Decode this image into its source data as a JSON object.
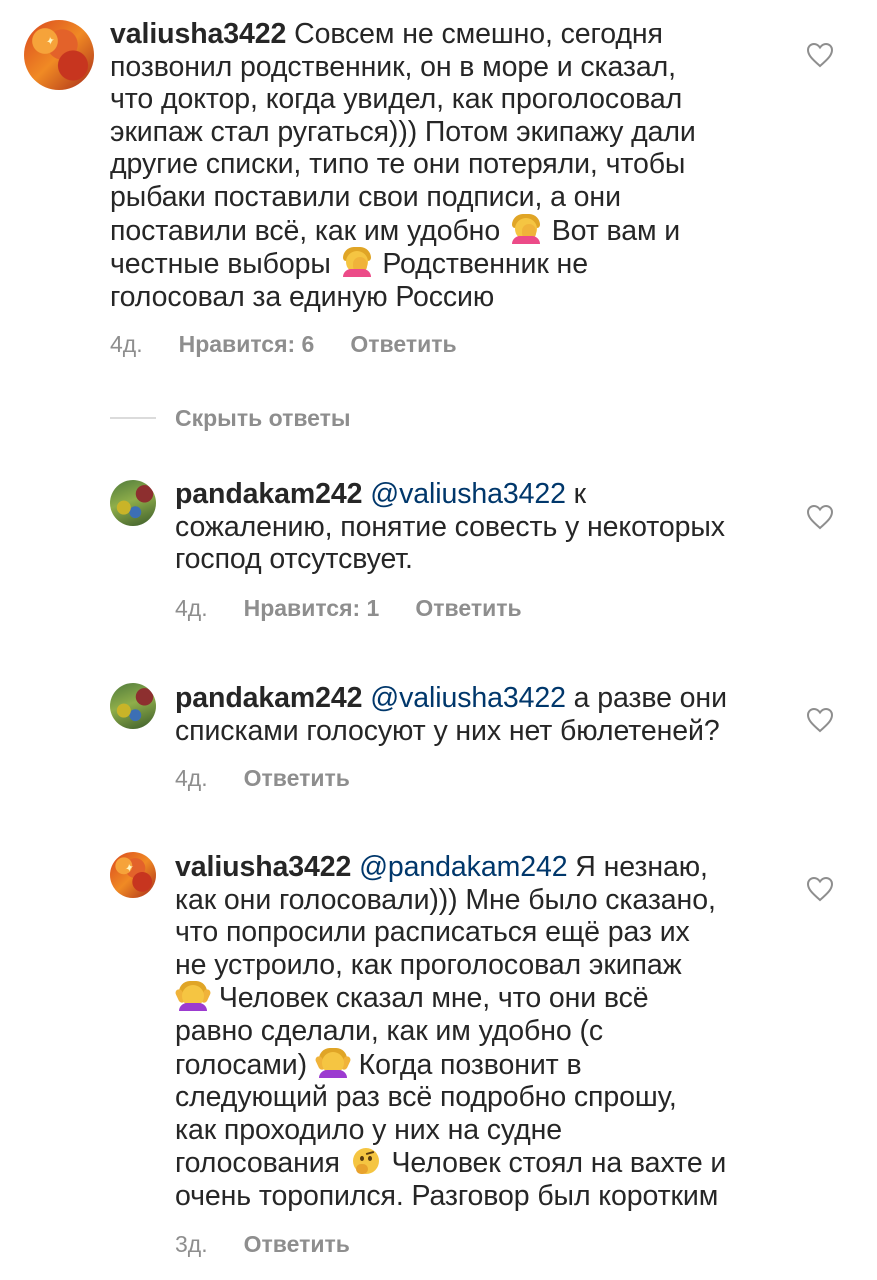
{
  "comments": [
    {
      "username": "valiusha3422",
      "lines": [
        " Совсем не смешно, сегодня",
        "позвонил родственник, он в море и сказал,",
        "что доктор, когда увидел, как проголосовал",
        "экипаж стал ругаться))) Потом экипажу дали",
        "другие списки, типо те они потеряли, чтобы",
        "рыбаки поставили свои подписи, а они",
        "поставили всё, как им удобно",
        " Вот вам и",
        "честные выборы",
        " Родственник не",
        "голосовал за единую Россию"
      ],
      "time": "4д.",
      "likes": "Нравится: 6",
      "reply": "Ответить",
      "avatar_icon": "avatar-orange-icon"
    },
    {
      "username": "pandakam242",
      "mention": "@valiusha3422",
      "lines": [
        " к",
        "сожалению, понятие совесть у некоторых",
        "господ отсутсвует."
      ],
      "time": "4д.",
      "likes": "Нравится: 1",
      "reply": "Ответить",
      "avatar_icon": "avatar-green-icon"
    },
    {
      "username": "pandakam242",
      "mention": "@valiusha3422",
      "lines": [
        " а разве они",
        "списками голосуют у них нет бюлетеней?"
      ],
      "time": "4д.",
      "reply": "Ответить",
      "avatar_icon": "avatar-green-icon"
    },
    {
      "username": "valiusha3422",
      "mention": "@pandakam242",
      "lines": [
        " Я незнаю,",
        "как они голосовали))) Мне было сказано,",
        "что попросили расписаться ещё раз их",
        "не устроило, как проголосовал экипаж",
        " Человек сказал мне, что они всё",
        "равно сделали, как им удобно (с",
        "голосами)",
        " Когда позвонит в",
        "следующий раз всё подробно спрошу,",
        "как проходило у них на судне",
        "голосования",
        " Человек стоял на вахте и",
        "очень торопился. Разговор был коротким"
      ],
      "time": "3д.",
      "reply": "Ответить",
      "avatar_icon": "avatar-orange-icon"
    }
  ],
  "hide_replies": "Скрыть ответы",
  "icons": {
    "like": "heart-outline-icon",
    "facepalm": "woman-facepalming-emoji",
    "shrug": "woman-shrugging-emoji",
    "thinking": "thinking-face-emoji"
  },
  "colors": {
    "text": "#262626",
    "secondary": "#8e8e8e",
    "mention": "#00376b",
    "divider": "#dbdbdb"
  }
}
